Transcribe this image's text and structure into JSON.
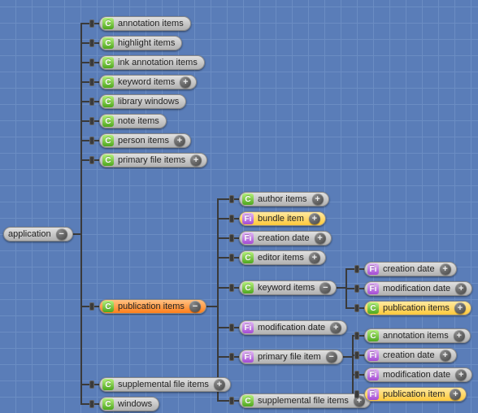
{
  "root": {
    "label": "application",
    "expanded": true,
    "kind": "plain"
  },
  "lvl1": [
    {
      "label": "annotation items",
      "kind": "C",
      "plus": false
    },
    {
      "label": "highlight items",
      "kind": "C",
      "plus": false
    },
    {
      "label": "ink annotation items",
      "kind": "C",
      "plus": false
    },
    {
      "label": "keyword items",
      "kind": "C",
      "plus": true
    },
    {
      "label": "library windows",
      "kind": "C",
      "plus": false
    },
    {
      "label": "note items",
      "kind": "C",
      "plus": false
    },
    {
      "label": "person items",
      "kind": "C",
      "plus": true
    },
    {
      "label": "primary file items",
      "kind": "C",
      "plus": true
    },
    {
      "label": "publication items",
      "kind": "C",
      "plus": false,
      "expanded": true,
      "hl": "orange"
    },
    {
      "label": "supplemental file items",
      "kind": "C",
      "plus": true
    },
    {
      "label": "windows",
      "kind": "C",
      "plus": false
    }
  ],
  "pub_children": [
    {
      "label": "author items",
      "kind": "C",
      "plus": true
    },
    {
      "label": "bundle item",
      "kind": "F",
      "plus": true,
      "hl": "yellow"
    },
    {
      "label": "creation date",
      "kind": "F",
      "plus": true
    },
    {
      "label": "editor items",
      "kind": "C",
      "plus": true
    },
    {
      "label": "keyword items",
      "kind": "C",
      "plus": false,
      "expanded": true
    },
    {
      "label": "modification date",
      "kind": "F",
      "plus": true
    },
    {
      "label": "primary file item",
      "kind": "F",
      "plus": false,
      "expanded": true
    },
    {
      "label": "supplemental file items",
      "kind": "C",
      "plus": true
    }
  ],
  "kw_children": [
    {
      "label": "creation date",
      "kind": "F",
      "plus": true
    },
    {
      "label": "modification date",
      "kind": "F",
      "plus": true
    },
    {
      "label": "publication items",
      "kind": "C",
      "plus": true,
      "hl": "yellow"
    }
  ],
  "pf_children": [
    {
      "label": "annotation items",
      "kind": "C",
      "plus": true
    },
    {
      "label": "creation date",
      "kind": "F",
      "plus": true
    },
    {
      "label": "modification date",
      "kind": "F",
      "plus": true
    },
    {
      "label": "publication item",
      "kind": "F",
      "plus": true,
      "hl": "yellow"
    }
  ],
  "glyph": {
    "plus": "+",
    "minus": "−"
  }
}
